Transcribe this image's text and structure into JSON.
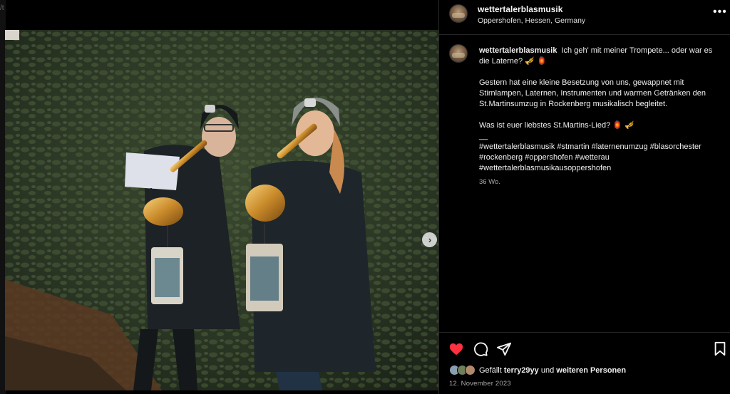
{
  "backdrop": {
    "glyph": "/t"
  },
  "post": {
    "username": "wettertalerblasmusik",
    "location": "Oppershofen, Hessen, Germany",
    "more_icon": "more-horizontal-icon",
    "caption": {
      "author": "wettertalerblasmusik",
      "line1": "Ich geh' mit meiner Trompete... oder war es die Laterne? 🎺 🏮",
      "paragraph2": "Gestern hat eine kleine Besetzung von uns, gewappnet mit Stirnlampen, Laternen, Instrumenten und warmen Getränken den St.Martinsumzug in Rockenberg musikalisch begleitet.",
      "paragraph3": "Was ist euer liebstes St.Martins-Lied? 🏮 🎺",
      "separator": "__",
      "hashtags": "#wettertalerblasmusik #stmartin #laternenumzug #blasorchester #rockenberg #oppershofen #wetterau #wettertalerblasmusikausoppershofen",
      "time_ago": "36 Wo."
    },
    "likes": {
      "prefix": "Gefällt",
      "user": "terry29yy",
      "conjunction": "und",
      "others": "weiteren Personen"
    },
    "date": "12. November 2023",
    "carousel": {
      "count": 4,
      "active": 0
    }
  },
  "icons": {
    "like": "heart-filled-icon",
    "comment": "comment-icon",
    "share": "send-icon",
    "save": "bookmark-icon",
    "next": "chevron-right-icon",
    "tags": "user-tag-icon"
  },
  "colors": {
    "like_red": "#ff3040",
    "panel_bg": "#000000",
    "secondary_text": "#a8a8a8"
  }
}
